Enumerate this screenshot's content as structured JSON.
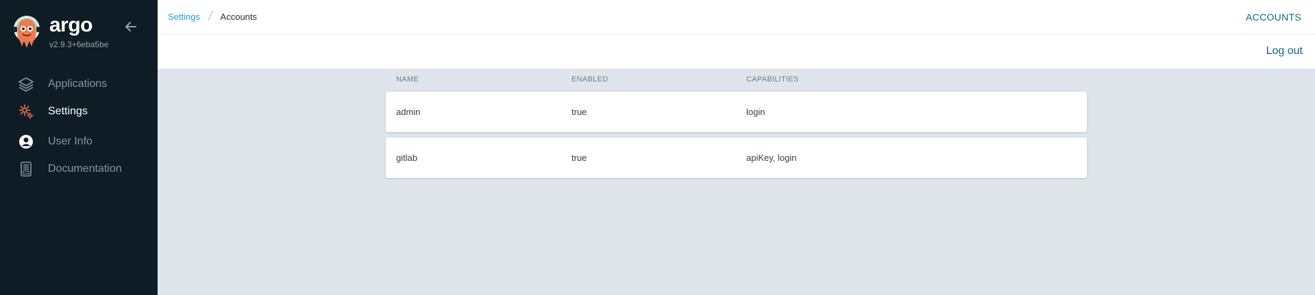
{
  "sidebar": {
    "brand_name": "argo",
    "version": "v2.9.3+6eba5be",
    "items": [
      {
        "label": "Applications",
        "icon": "layers-icon"
      },
      {
        "label": "Settings",
        "icon": "gear-icon"
      },
      {
        "label": "User Info",
        "icon": "user-circle-icon"
      },
      {
        "label": "Documentation",
        "icon": "book-icon"
      }
    ]
  },
  "breadcrumb": {
    "parent": "Settings",
    "current": "Accounts"
  },
  "header": {
    "title": "ACCOUNTS",
    "logout": "Log out"
  },
  "table": {
    "columns": [
      "NAME",
      "ENABLED",
      "CAPABILITIES"
    ],
    "rows": [
      {
        "name": "admin",
        "enabled": "true",
        "capabilities": "login"
      },
      {
        "name": "gitlab",
        "enabled": "true",
        "capabilities": "apiKey, login"
      }
    ]
  },
  "colors": {
    "sidebar_bg": "#0e1c26",
    "accent": "#0e6580",
    "link": "#1f9ec7",
    "content_bg": "#dee6eb",
    "active_icon": "#e96d4b"
  }
}
